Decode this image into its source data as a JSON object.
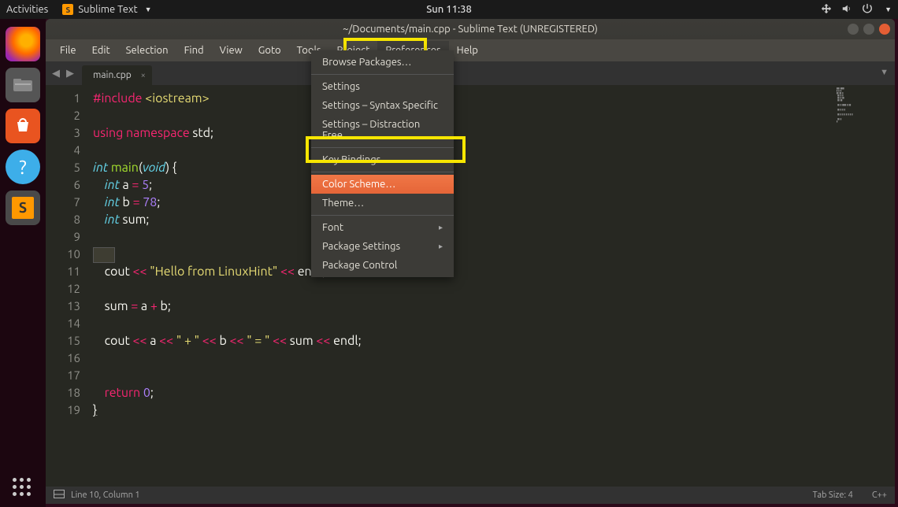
{
  "topbar": {
    "activities": "Activities",
    "app_name": "Sublime Text",
    "clock": "Sun 11:38"
  },
  "window": {
    "title": "~/Documents/main.cpp - Sublime Text (UNREGISTERED)"
  },
  "menubar": {
    "items": [
      "File",
      "Edit",
      "Selection",
      "Find",
      "View",
      "Goto",
      "Tools",
      "Project",
      "Preferences",
      "Help"
    ]
  },
  "tabs": {
    "active": "main.cpp"
  },
  "dropdown": {
    "items": [
      {
        "label": "Browse Packages…",
        "sep_after": true
      },
      {
        "label": "Settings"
      },
      {
        "label": "Settings – Syntax Specific"
      },
      {
        "label": "Settings – Distraction Free",
        "sep_after": true
      },
      {
        "label": "Key Bindings",
        "sep_after": true
      },
      {
        "label": "Color Scheme…",
        "hover": true
      },
      {
        "label": "Theme…",
        "sep_after": true
      },
      {
        "label": "Font",
        "submenu": true
      },
      {
        "label": "Package Settings",
        "submenu": true
      },
      {
        "label": "Package Control"
      }
    ]
  },
  "code": {
    "lines_count": 19,
    "current_line": 10
  },
  "status": {
    "position": "Line 10, Column 1",
    "tab_size": "Tab Size: 4",
    "syntax": "C++"
  },
  "tokens": {
    "include": "#include",
    "iostream": "<iostream>",
    "using": "using",
    "namespace": "namespace",
    "std": "std",
    "int": "int",
    "main": "main",
    "void": "void",
    "a": "a",
    "b": "b",
    "sum": "sum",
    "eq": "=",
    "semi": ";",
    "lb": "{",
    "rb": "}",
    "lp": "(",
    "rp": ")",
    "five": "5",
    "seventyeight": "78",
    "cout": "cout",
    "ll": "<<",
    "hello_str": "\"Hello from LinuxHint\"",
    "endl": "endl",
    "plus": "+",
    "plus_str": "\" + \"",
    "eq_str": "\" = \"",
    "return": "return",
    "zero": "0"
  }
}
